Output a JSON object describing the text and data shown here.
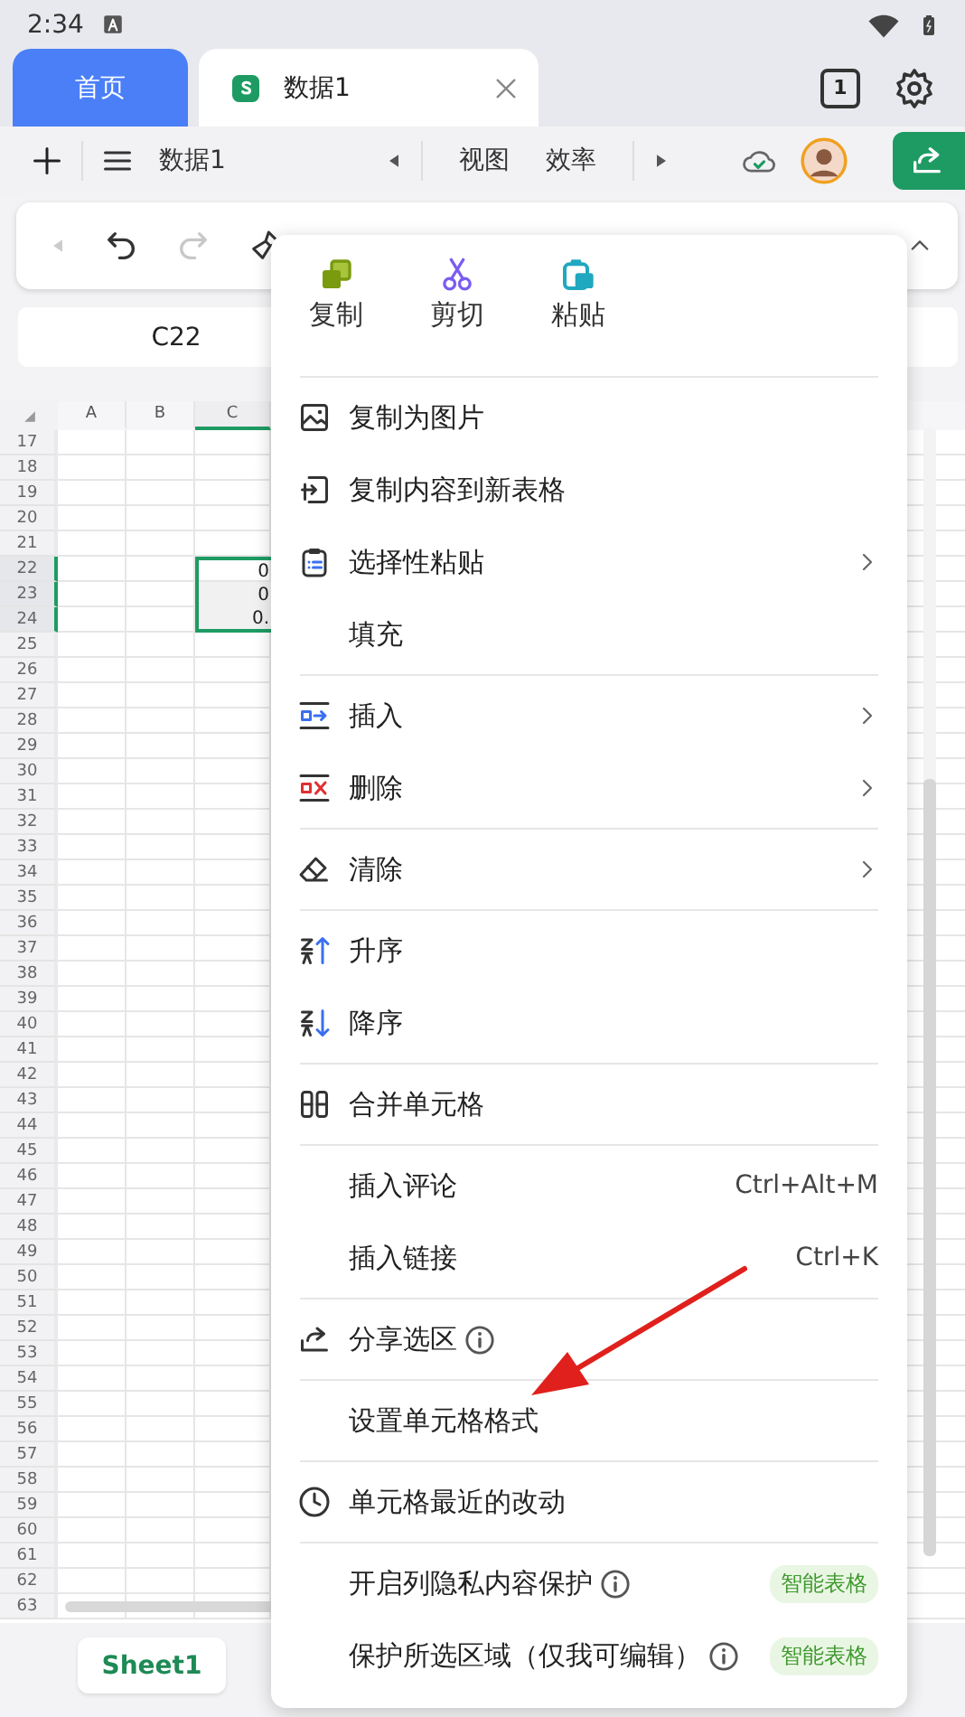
{
  "status_bar": {
    "time": "2:34"
  },
  "tabs": [
    {
      "kind": "home",
      "label": "首页",
      "selected": false
    },
    {
      "kind": "document",
      "label": "数据1",
      "selected": true
    }
  ],
  "tab_count": "1",
  "toolbar": {
    "title": "数据1",
    "menus": [
      "视图",
      "效率"
    ]
  },
  "format_toolbar": {
    "back_disabled": true,
    "redo_disabled": true
  },
  "name_box": "C22",
  "sheet": {
    "columns": [
      {
        "label": "A",
        "selected": false
      },
      {
        "label": "B",
        "selected": false
      },
      {
        "label": "C",
        "selected": true
      }
    ],
    "rows": [
      {
        "label": "17",
        "selected": false
      },
      {
        "label": "18",
        "selected": false
      },
      {
        "label": "19",
        "selected": false
      },
      {
        "label": "20",
        "selected": false
      },
      {
        "label": "21",
        "selected": false
      },
      {
        "label": "22",
        "selected": true,
        "column_c": "0"
      },
      {
        "label": "23",
        "selected": true,
        "column_c": "0"
      },
      {
        "label": "24",
        "selected": true,
        "column_c": "0."
      },
      {
        "label": "25",
        "selected": false
      },
      {
        "label": "26",
        "selected": false
      },
      {
        "label": "27",
        "selected": false
      },
      {
        "label": "28",
        "selected": false
      },
      {
        "label": "29",
        "selected": false
      },
      {
        "label": "30",
        "selected": false
      },
      {
        "label": "31",
        "selected": false
      },
      {
        "label": "32",
        "selected": false
      },
      {
        "label": "33",
        "selected": false
      },
      {
        "label": "34",
        "selected": false
      },
      {
        "label": "35",
        "selected": false
      },
      {
        "label": "36",
        "selected": false
      },
      {
        "label": "37",
        "selected": false
      },
      {
        "label": "38",
        "selected": false
      },
      {
        "label": "39",
        "selected": false
      },
      {
        "label": "40",
        "selected": false
      },
      {
        "label": "41",
        "selected": false
      },
      {
        "label": "42",
        "selected": false
      },
      {
        "label": "43",
        "selected": false
      },
      {
        "label": "44",
        "selected": false
      },
      {
        "label": "45",
        "selected": false
      },
      {
        "label": "46",
        "selected": false
      },
      {
        "label": "47",
        "selected": false
      },
      {
        "label": "48",
        "selected": false
      },
      {
        "label": "49",
        "selected": false
      },
      {
        "label": "50",
        "selected": false
      },
      {
        "label": "51",
        "selected": false
      },
      {
        "label": "52",
        "selected": false
      },
      {
        "label": "53",
        "selected": false
      },
      {
        "label": "54",
        "selected": false
      },
      {
        "label": "55",
        "selected": false
      },
      {
        "label": "56",
        "selected": false
      },
      {
        "label": "57",
        "selected": false
      },
      {
        "label": "58",
        "selected": false
      },
      {
        "label": "59",
        "selected": false
      },
      {
        "label": "60",
        "selected": false
      },
      {
        "label": "61",
        "selected": false
      },
      {
        "label": "62",
        "selected": false
      },
      {
        "label": "63",
        "selected": false
      }
    ]
  },
  "sheet_tabs": [
    {
      "label": "Sheet1",
      "selected": true
    }
  ],
  "context_menu": {
    "quick_actions": [
      {
        "label": "复制"
      },
      {
        "label": "剪切"
      },
      {
        "label": "粘贴"
      }
    ],
    "groups": [
      {
        "items": [
          {
            "label": "复制为图片"
          },
          {
            "label": "复制内容到新表格"
          },
          {
            "label": "选择性粘贴",
            "submenu": true
          },
          {
            "label": "填充"
          }
        ]
      },
      {
        "items": [
          {
            "label": "插入",
            "submenu": true
          },
          {
            "label": "删除",
            "submenu": true
          }
        ]
      },
      {
        "items": [
          {
            "label": "清除",
            "submenu": true
          }
        ]
      },
      {
        "items": [
          {
            "label": "升序"
          },
          {
            "label": "降序"
          }
        ]
      },
      {
        "items": [
          {
            "label": "合并单元格"
          }
        ]
      },
      {
        "items": [
          {
            "label": "插入评论",
            "shortcut": "Ctrl+Alt+M"
          },
          {
            "label": "插入链接",
            "shortcut": "Ctrl+K"
          }
        ]
      },
      {
        "items": [
          {
            "label": "分享选区",
            "info": true
          }
        ]
      },
      {
        "items": [
          {
            "label": "设置单元格格式"
          }
        ]
      },
      {
        "items": [
          {
            "label": "单元格最近的改动"
          }
        ]
      },
      {
        "items": [
          {
            "label": "开启列隐私内容保护",
            "info": true,
            "badge": "智能表格"
          },
          {
            "label": "保护所选区域（仅我可编辑）",
            "info": true,
            "badge": "智能表格"
          }
        ]
      }
    ]
  }
}
